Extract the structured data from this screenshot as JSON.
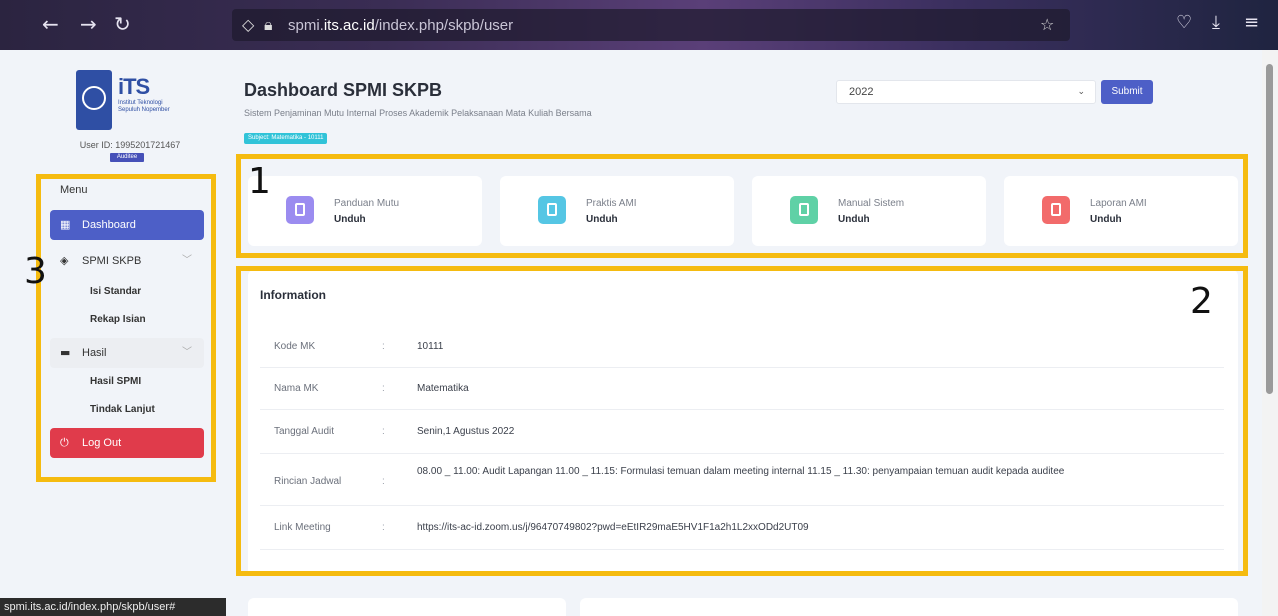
{
  "browser": {
    "url_prefix": "spmi.",
    "url_domain": "its.ac.id",
    "url_path": "/index.php/skpb/user",
    "status_url": "spmi.its.ac.id/index.php/skpb/user#"
  },
  "logo": {
    "name": "iTS",
    "sub": "Institut Teknologi Sepuluh Nopember"
  },
  "user": {
    "id_label": "User ID: 1995201721467",
    "role": "Auditee"
  },
  "sidebar": {
    "menu_title": "Menu",
    "dashboard": "Dashboard",
    "spmi_skpb": "SPMI SKPB",
    "spmi_children": [
      "Isi Standar",
      "Rekap Isian"
    ],
    "hasil": "Hasil",
    "hasil_children": [
      "Hasil SPMI",
      "Tindak Lanjut"
    ],
    "logout": "Log Out"
  },
  "header": {
    "title": "Dashboard SPMI SKPB",
    "subtitle": "Sistem Penjaminan Mutu Internal Proses Akademik Pelaksanaan Mata Kuliah Bersama",
    "badge": "Subject: Matematika - 10111",
    "year": "2022",
    "submit": "Submit"
  },
  "cards": [
    {
      "title": "Panduan Mutu",
      "action": "Unduh",
      "color": "#9b8cf0"
    },
    {
      "title": "Praktis AMI",
      "action": "Unduh",
      "color": "#55c6e4"
    },
    {
      "title": "Manual Sistem",
      "action": "Unduh",
      "color": "#5fd1a6"
    },
    {
      "title": "Laporan AMI",
      "action": "Unduh",
      "color": "#f26b6b"
    }
  ],
  "info": {
    "title": "Information",
    "rows": [
      {
        "key": "Kode MK",
        "value": "10111"
      },
      {
        "key": "Nama MK",
        "value": "Matematika"
      },
      {
        "key": "Tanggal Audit",
        "value": "Senin,1 Agustus 2022"
      },
      {
        "key": "Rincian Jadwal",
        "value": "08.00 _ 11.00: Audit Lapangan 11.00 _ 11.15: Formulasi temuan dalam meeting internal 11.15 _ 11.30: penyampaian temuan audit kepada auditee"
      },
      {
        "key": "Link Meeting",
        "value": "https://its-ac-id.zoom.us/j/96470749802?pwd=eEtIR29maE5HV1F1a2h1L2xxODd2UT09"
      }
    ],
    "separator": ":"
  },
  "annotations": [
    "1",
    "2",
    "3"
  ]
}
